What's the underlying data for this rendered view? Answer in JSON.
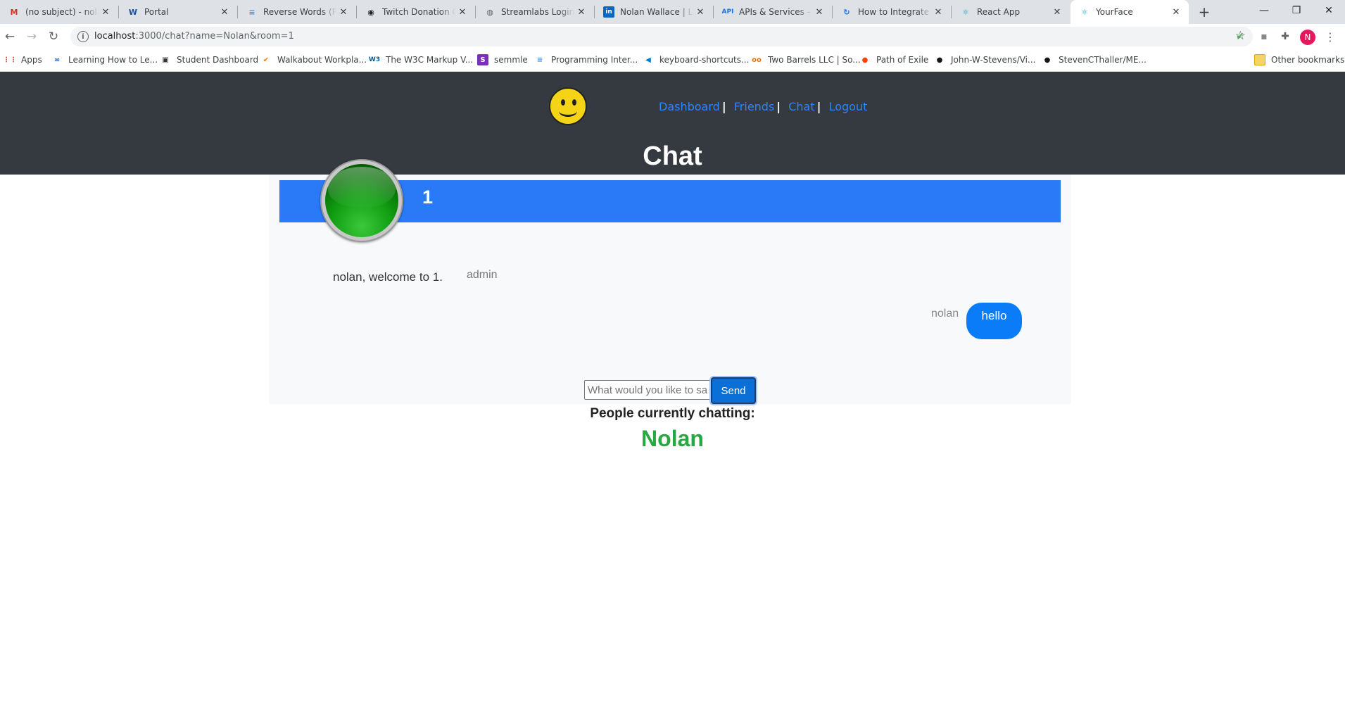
{
  "browser": {
    "tabs": [
      {
        "title": "(no subject) - nolan",
        "icon": "gmail-icon",
        "glyph": "M",
        "color": "#d93025"
      },
      {
        "title": "Portal",
        "icon": "w-icon",
        "glyph": "W",
        "color": "#1a4f9c"
      },
      {
        "title": "Reverse Words (Prac",
        "icon": "stack-icon",
        "glyph": "≡",
        "color": "#4a90d9"
      },
      {
        "title": "Twitch Donation Go",
        "icon": "twitch-icon",
        "glyph": "◉",
        "color": "#202124"
      },
      {
        "title": "Streamlabs Login",
        "icon": "globe-icon",
        "glyph": "◍",
        "color": "#5f6368"
      },
      {
        "title": "Nolan Wallace | Link",
        "icon": "linkedin-icon",
        "glyph": "in",
        "color": "#0a66c2"
      },
      {
        "title": "APIs & Services – AI",
        "icon": "api-icon",
        "glyph": "API",
        "color": "#1a73e8"
      },
      {
        "title": "How to Integrate th",
        "icon": "refresh-icon",
        "glyph": "↻",
        "color": "#1a73e8"
      },
      {
        "title": "React App",
        "icon": "react-icon",
        "glyph": "⚛",
        "color": "#20a4c7"
      },
      {
        "title": "YourFace",
        "icon": "react-icon",
        "glyph": "⚛",
        "color": "#20a4c7"
      }
    ],
    "url_host": "localhost",
    "url_rest": ":3000/chat?name=Nolan&room=1",
    "profile_initial": "N",
    "bookmarks": [
      {
        "label": "Apps",
        "icon": "apps-grid-icon",
        "glyph": "⋮⋮",
        "color": "#e8453c"
      },
      {
        "label": "Learning How to Le...",
        "icon": "coursera-icon",
        "glyph": "∞",
        "color": "#0056d2"
      },
      {
        "label": "Student Dashboard",
        "icon": "dashboard-icon",
        "glyph": "▣",
        "color": "#333"
      },
      {
        "label": "Walkabout Workpla...",
        "icon": "walkabout-icon",
        "glyph": "✔",
        "color": "#f57c00"
      },
      {
        "label": "The W3C Markup V...",
        "icon": "w3c-icon",
        "glyph": "W3",
        "color": "#005a9c"
      },
      {
        "label": "semmle",
        "icon": "semmle-icon",
        "glyph": "S",
        "color": "#7b2fbe"
      },
      {
        "label": "Programming Inter...",
        "icon": "stack-icon",
        "glyph": "≡",
        "color": "#4a90d9"
      },
      {
        "label": "keyboard-shortcuts...",
        "icon": "vscode-icon",
        "glyph": "◀",
        "color": "#0078d4"
      },
      {
        "label": "Two Barrels LLC | So...",
        "icon": "link-icon",
        "glyph": "oo",
        "color": "#e8710a"
      },
      {
        "label": "Path of Exile",
        "icon": "reddit-icon",
        "glyph": "●",
        "color": "#ff4500"
      },
      {
        "label": "John-W-Stevens/Vi...",
        "icon": "github-icon",
        "glyph": "●",
        "color": "#181717"
      },
      {
        "label": "StevenCThaller/ME...",
        "icon": "github-icon",
        "glyph": "●",
        "color": "#181717"
      }
    ],
    "other_bookmarks": "Other bookmarks"
  },
  "nav": {
    "dashboard": "Dashboard",
    "friends": "Friends",
    "chat": "Chat",
    "logout": "Logout",
    "sep": "|"
  },
  "page": {
    "title": "Chat",
    "room": "1"
  },
  "messages": [
    {
      "sender": "admin",
      "text": "nolan, welcome to 1."
    },
    {
      "sender": "nolan",
      "text": "hello"
    }
  ],
  "composer": {
    "placeholder": "What would you like to say?",
    "send_label": "Send"
  },
  "people": {
    "label": "People currently chatting:",
    "names": [
      "Nolan"
    ]
  },
  "colors": {
    "header_bg": "#343a40",
    "room_bar": "#2a7af8",
    "bubble": "#0a7cf7",
    "online_name": "#28a745",
    "link": "#2b86ff"
  }
}
